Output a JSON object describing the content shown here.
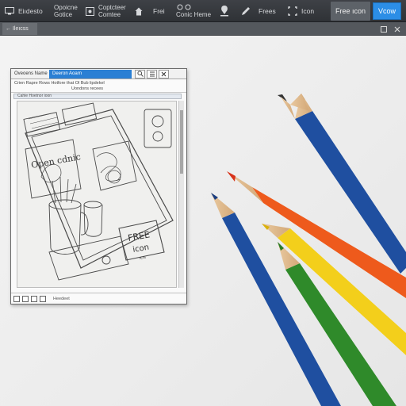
{
  "toolbar": {
    "item1": {
      "label": "Eiıdesto",
      "icon": "monitor-icon"
    },
    "item2": {
      "line1": "Opoicne",
      "line2": "Gotice",
      "icon": "sliders-icon"
    },
    "item3": {
      "line1": "Coptcteer",
      "line2": "Comtee",
      "icon": "image-frame-icon"
    },
    "item4": {
      "label": "Frei",
      "icon": "home-icon"
    },
    "item5": {
      "label": "Conic Heme",
      "icon": "pin-pair-icon"
    },
    "item6": {
      "label": "",
      "icon": "location-icon"
    },
    "item7": {
      "label": "Frees",
      "icon": "pencil-icon"
    },
    "item8": {
      "label": "Icon",
      "icon": "crop-icon"
    },
    "free_icon_button": "Free ıcon",
    "view_button": "Vcow"
  },
  "subbar": {
    "tab_label": "← Ileıcss",
    "right_icons": [
      "square-icon",
      "close-icon"
    ]
  },
  "window": {
    "title": "Oveoens Name",
    "tab": "Deeron Aoarn",
    "menu_line1": "Crien Rapre Rows  Hotfore that Ol Bub lipdekel",
    "menu_line2": "Uondons recees",
    "path": "Cahle Hoetnor ioon",
    "status_text": "Heedeet",
    "sketch_text_1": "Open cdnic",
    "sketch_text_2": "FREE",
    "sketch_text_3": "icon",
    "sketch_text_4": "ıcıs"
  },
  "colors": {
    "toolbar_bg": "#34373b",
    "accent_blue": "#2c8ee6",
    "window_tab": "#2a7fd4",
    "pencil_blue": "#1f4fa0",
    "pencil_orange": "#ee5a1c",
    "pencil_yellow": "#f3cf1b",
    "pencil_green": "#2f8a2a"
  }
}
